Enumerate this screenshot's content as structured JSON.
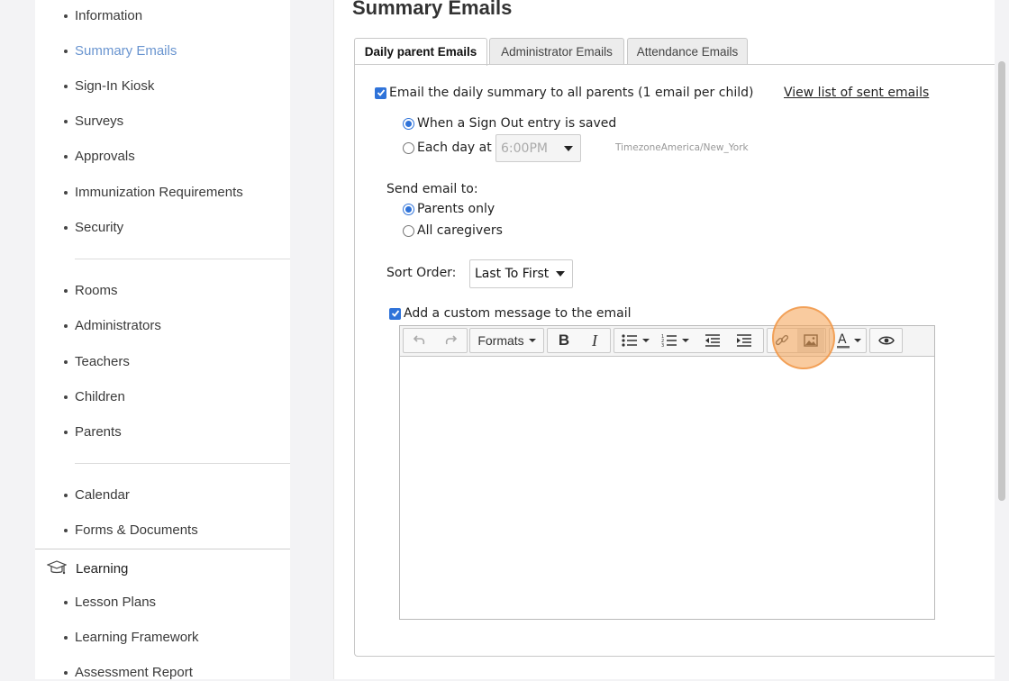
{
  "sidebar": {
    "group1": [
      "Information",
      "Summary Emails",
      "Sign-In Kiosk",
      "Surveys",
      "Approvals",
      "Immunization Requirements",
      "Security"
    ],
    "group2": [
      "Rooms",
      "Administrators",
      "Teachers",
      "Children",
      "Parents"
    ],
    "group3": [
      "Calendar",
      "Forms & Documents"
    ],
    "learning_section": "Learning",
    "group4": [
      "Lesson Plans",
      "Learning Framework",
      "Assessment Report"
    ],
    "active_item": "Summary Emails"
  },
  "page": {
    "title": "Summary Emails"
  },
  "tabs": [
    "Daily parent Emails",
    "Administrator Emails",
    "Attendance Emails"
  ],
  "form": {
    "daily_summary_label": "Email the daily summary to all parents (1 email per child)",
    "view_sent_link": "View list of sent emails",
    "when_signout_label": "When a Sign Out entry is saved",
    "each_day_label": "Each day at",
    "time_value": "6:00PM",
    "timezone_text": "TimezoneAmerica/New_York",
    "send_to_label": "Send email to:",
    "parents_only_label": "Parents only",
    "all_caregivers_label": "All caregivers",
    "sort_order_label": "Sort Order:",
    "sort_order_value": "Last To First",
    "custom_message_label": "Add a custom message to the email"
  },
  "editor": {
    "formats_label": "Formats"
  },
  "colors": {
    "accent": "#2f73d9",
    "active_link": "#6a95d0",
    "highlight": "#f4a050"
  }
}
